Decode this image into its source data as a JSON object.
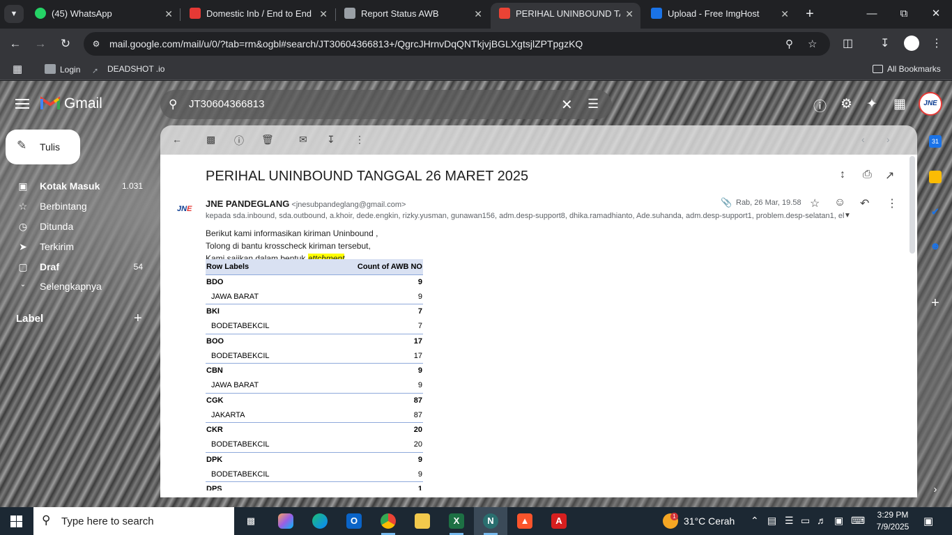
{
  "browser": {
    "tabs": [
      {
        "title": "(45) WhatsApp",
        "icon": "whatsapp-icon",
        "color": "#25d366",
        "active": false
      },
      {
        "title": "Domestic Inb / End to End",
        "icon": "sheets-icon",
        "color": "#e53935",
        "active": false
      },
      {
        "title": "Report Status AWB",
        "icon": "report-icon",
        "color": "#9aa0a6",
        "active": false
      },
      {
        "title": "PERIHAL UNINBOUND TANGGAL 26 MARET 2025",
        "icon": "gmail-icon",
        "color": "#ea4335",
        "active": true
      },
      {
        "title": "Upload - Free ImgHost",
        "icon": "imghost-icon",
        "color": "#1a73e8",
        "active": false
      }
    ],
    "url": "mail.google.com/mail/u/0/?tab=rm&ogbl#search/JT30604366813+/QgrcJHrnvDqQNTkjvjBGLXgtsjlZPTpgzKQ",
    "bookmarks": {
      "apps_icon": "apps-grid-icon",
      "items": [
        {
          "label": "Login",
          "icon": "login-favicon"
        },
        {
          "label": "DEADSHOT .io",
          "icon": "deadshot-favicon"
        }
      ],
      "all_label": "All Bookmarks"
    }
  },
  "gmail": {
    "brand": "Gmail",
    "search_query": "JT30604366813",
    "compose_label": "Tulis",
    "nav": [
      {
        "label": "Kotak Masuk",
        "count": "1.031",
        "icon": "inbox-icon",
        "bold": true
      },
      {
        "label": "Berbintang",
        "count": "",
        "icon": "star-icon",
        "bold": false
      },
      {
        "label": "Ditunda",
        "count": "",
        "icon": "clock-icon",
        "bold": false
      },
      {
        "label": "Terkirim",
        "count": "",
        "icon": "send-icon",
        "bold": false
      },
      {
        "label": "Draf",
        "count": "54",
        "icon": "draft-icon",
        "bold": true
      },
      {
        "label": "Selengkapnya",
        "count": "",
        "icon": "chevron-down-icon",
        "bold": false
      }
    ],
    "labels_heading": "Label",
    "account_avatar_text": "JNE",
    "message": {
      "subject": "PERIHAL UNINBOUND TANGGAL 26 MARET 2025",
      "sender_name": "JNE PANDEGLANG",
      "sender_email": "<jnesubpandeglang@gmail.com>",
      "sender_logo": "JNE",
      "date": "Rab, 26 Mar, 19.58",
      "recipients": "kepada sda.inbound, sda.outbound, a.khoir, dede.engkin, rizky.yusman, gunawan156, adm.desp-support8, dhika.ramadhianto, Ade.suhanda, adm.desp-support1, problem.desp-selatan1, el",
      "body_lines": [
        "Berikut kami informasikan kiriman Uninbound ,",
        "Tolong di bantu krosscheck kiriman tersebut,"
      ],
      "body_line3_prefix": "Kami sajikan dalam bentuk ",
      "body_line3_highlight": "attchment",
      "table": {
        "header": [
          "Row Labels",
          "Count of AWB NO"
        ],
        "rows": [
          {
            "label": "BDO",
            "value": "9",
            "group": true
          },
          {
            "label": "JAWA BARAT",
            "value": "9",
            "group": false
          },
          {
            "label": "BKI",
            "value": "7",
            "group": true
          },
          {
            "label": "BODETABEKCIL",
            "value": "7",
            "group": false
          },
          {
            "label": "BOO",
            "value": "17",
            "group": true
          },
          {
            "label": "BODETABEKCIL",
            "value": "17",
            "group": false
          },
          {
            "label": "CBN",
            "value": "9",
            "group": true
          },
          {
            "label": "JAWA BARAT",
            "value": "9",
            "group": false
          },
          {
            "label": "CGK",
            "value": "87",
            "group": true
          },
          {
            "label": "JAKARTA",
            "value": "87",
            "group": false
          },
          {
            "label": "CKR",
            "value": "20",
            "group": true
          },
          {
            "label": "BODETABEKCIL",
            "value": "20",
            "group": false
          },
          {
            "label": "DPK",
            "value": "9",
            "group": true
          },
          {
            "label": "BODETABEKCIL",
            "value": "9",
            "group": false
          },
          {
            "label": "DPS",
            "value": "1",
            "group": true
          }
        ]
      }
    }
  },
  "taskbar": {
    "search_placeholder": "Type here to search",
    "weather": "31°C  Cerah",
    "weather_badge": "1",
    "time": "3:29 PM",
    "date": "7/9/2025",
    "notification_count": "1"
  }
}
